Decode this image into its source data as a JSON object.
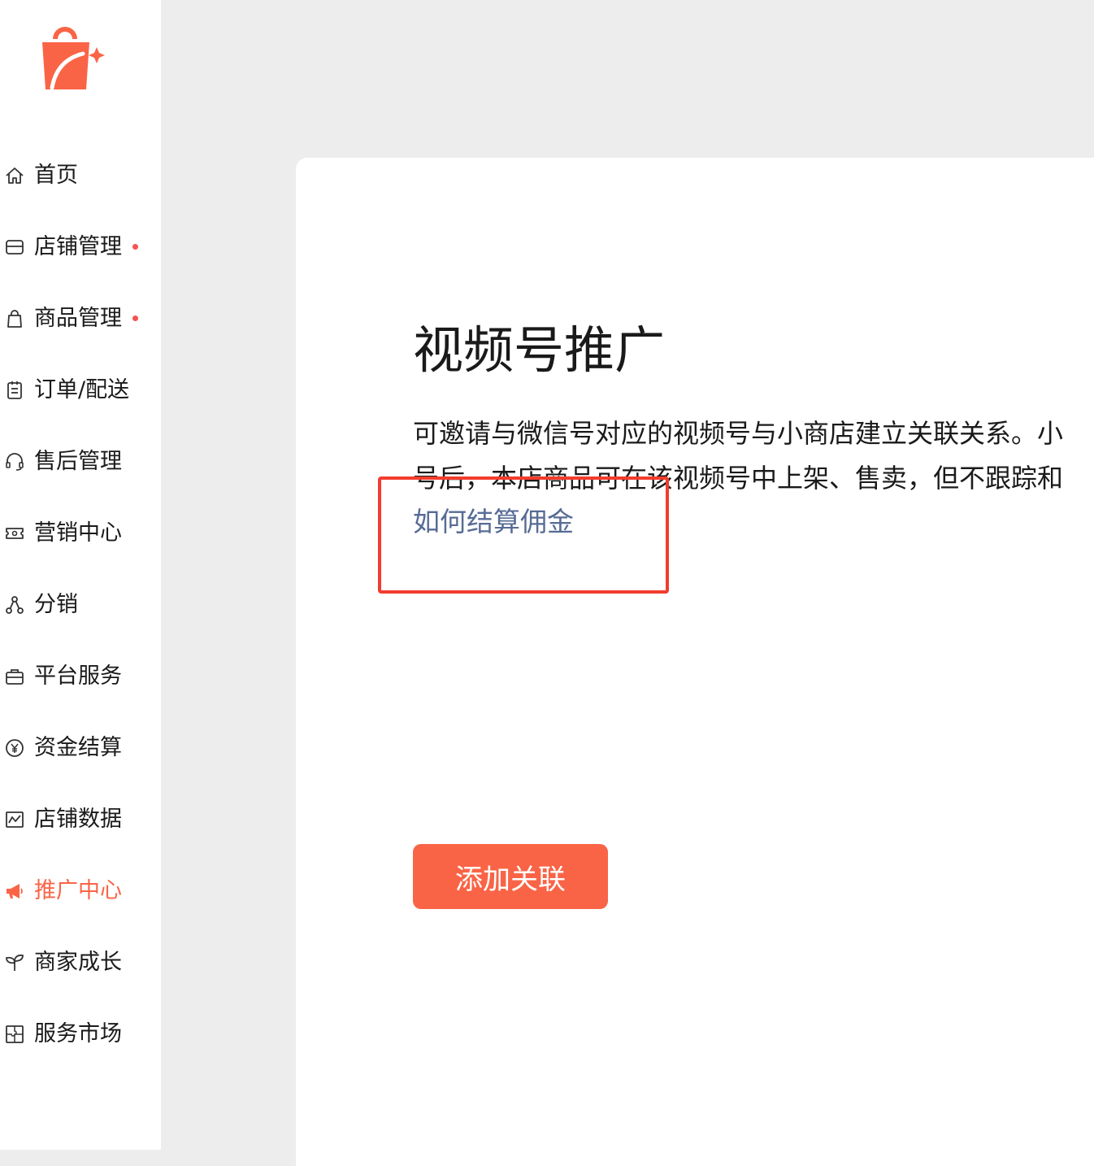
{
  "sidebar": {
    "logo_icon": "shopping-bag-sparkle-icon",
    "items": [
      {
        "label": "首页",
        "icon": "home-icon"
      },
      {
        "label": "店铺管理",
        "icon": "store-icon",
        "dot": true
      },
      {
        "label": "商品管理",
        "icon": "bag-icon",
        "dot": true
      },
      {
        "label": "订单/配送",
        "icon": "clipboard-icon"
      },
      {
        "label": "售后管理",
        "icon": "headset-icon"
      },
      {
        "label": "营销中心",
        "icon": "ticket-icon"
      },
      {
        "label": "分销",
        "icon": "share-nodes-icon"
      },
      {
        "label": "平台服务",
        "icon": "briefcase-icon"
      },
      {
        "label": "资金结算",
        "icon": "yen-circle-icon"
      },
      {
        "label": "店铺数据",
        "icon": "chart-line-icon"
      },
      {
        "label": "推广中心",
        "icon": "megaphone-icon",
        "active": true
      },
      {
        "label": "商家成长",
        "icon": "sprout-icon"
      },
      {
        "label": "服务市场",
        "icon": "puzzle-icon"
      }
    ]
  },
  "main": {
    "title": "视频号推广",
    "description_line1": "可邀请与微信号对应的视频号与小商店建立关联关系。小",
    "description_line2": "号后，本店商品可在该视频号中上架、售卖，但不跟踪和",
    "help_link": "如何结算佣金",
    "add_button": "添加关联"
  },
  "colors": {
    "accent": "#fa6446",
    "link": "#576b95",
    "highlight": "#f23c2e",
    "dot": "#fa5151"
  }
}
